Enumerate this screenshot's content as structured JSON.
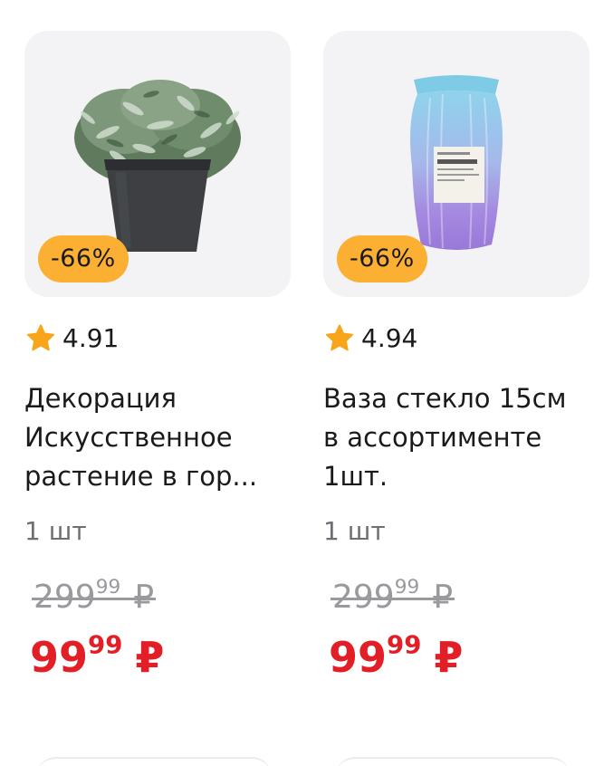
{
  "products": [
    {
      "image_alt": "plant-in-pot",
      "discount": "-66%",
      "rating": "4.91",
      "title_lines": [
        "Декорация",
        "Искусственное",
        "растение в гор..."
      ],
      "unit": "1 шт",
      "old_price": {
        "int": "299",
        "frac": "99",
        "currency": "₽"
      },
      "new_price": {
        "int": "99",
        "frac": "99",
        "currency": "₽"
      }
    },
    {
      "image_alt": "glass-vase",
      "discount": "-66%",
      "rating": "4.94",
      "title_lines": [
        "Ваза стекло 15см",
        "в ассортименте",
        "1шт."
      ],
      "unit": "1 шт",
      "old_price": {
        "int": "299",
        "frac": "99",
        "currency": "₽"
      },
      "new_price": {
        "int": "99",
        "frac": "99",
        "currency": "₽"
      }
    }
  ],
  "colors": {
    "badge": "#fbb034",
    "star": "#f8a51b",
    "new_price": "#e21f26",
    "old_price": "#9a9a9e",
    "muted_text": "#6f6f73",
    "image_bg": "#f3f3f5"
  },
  "icons": {
    "rating": "star-icon"
  }
}
